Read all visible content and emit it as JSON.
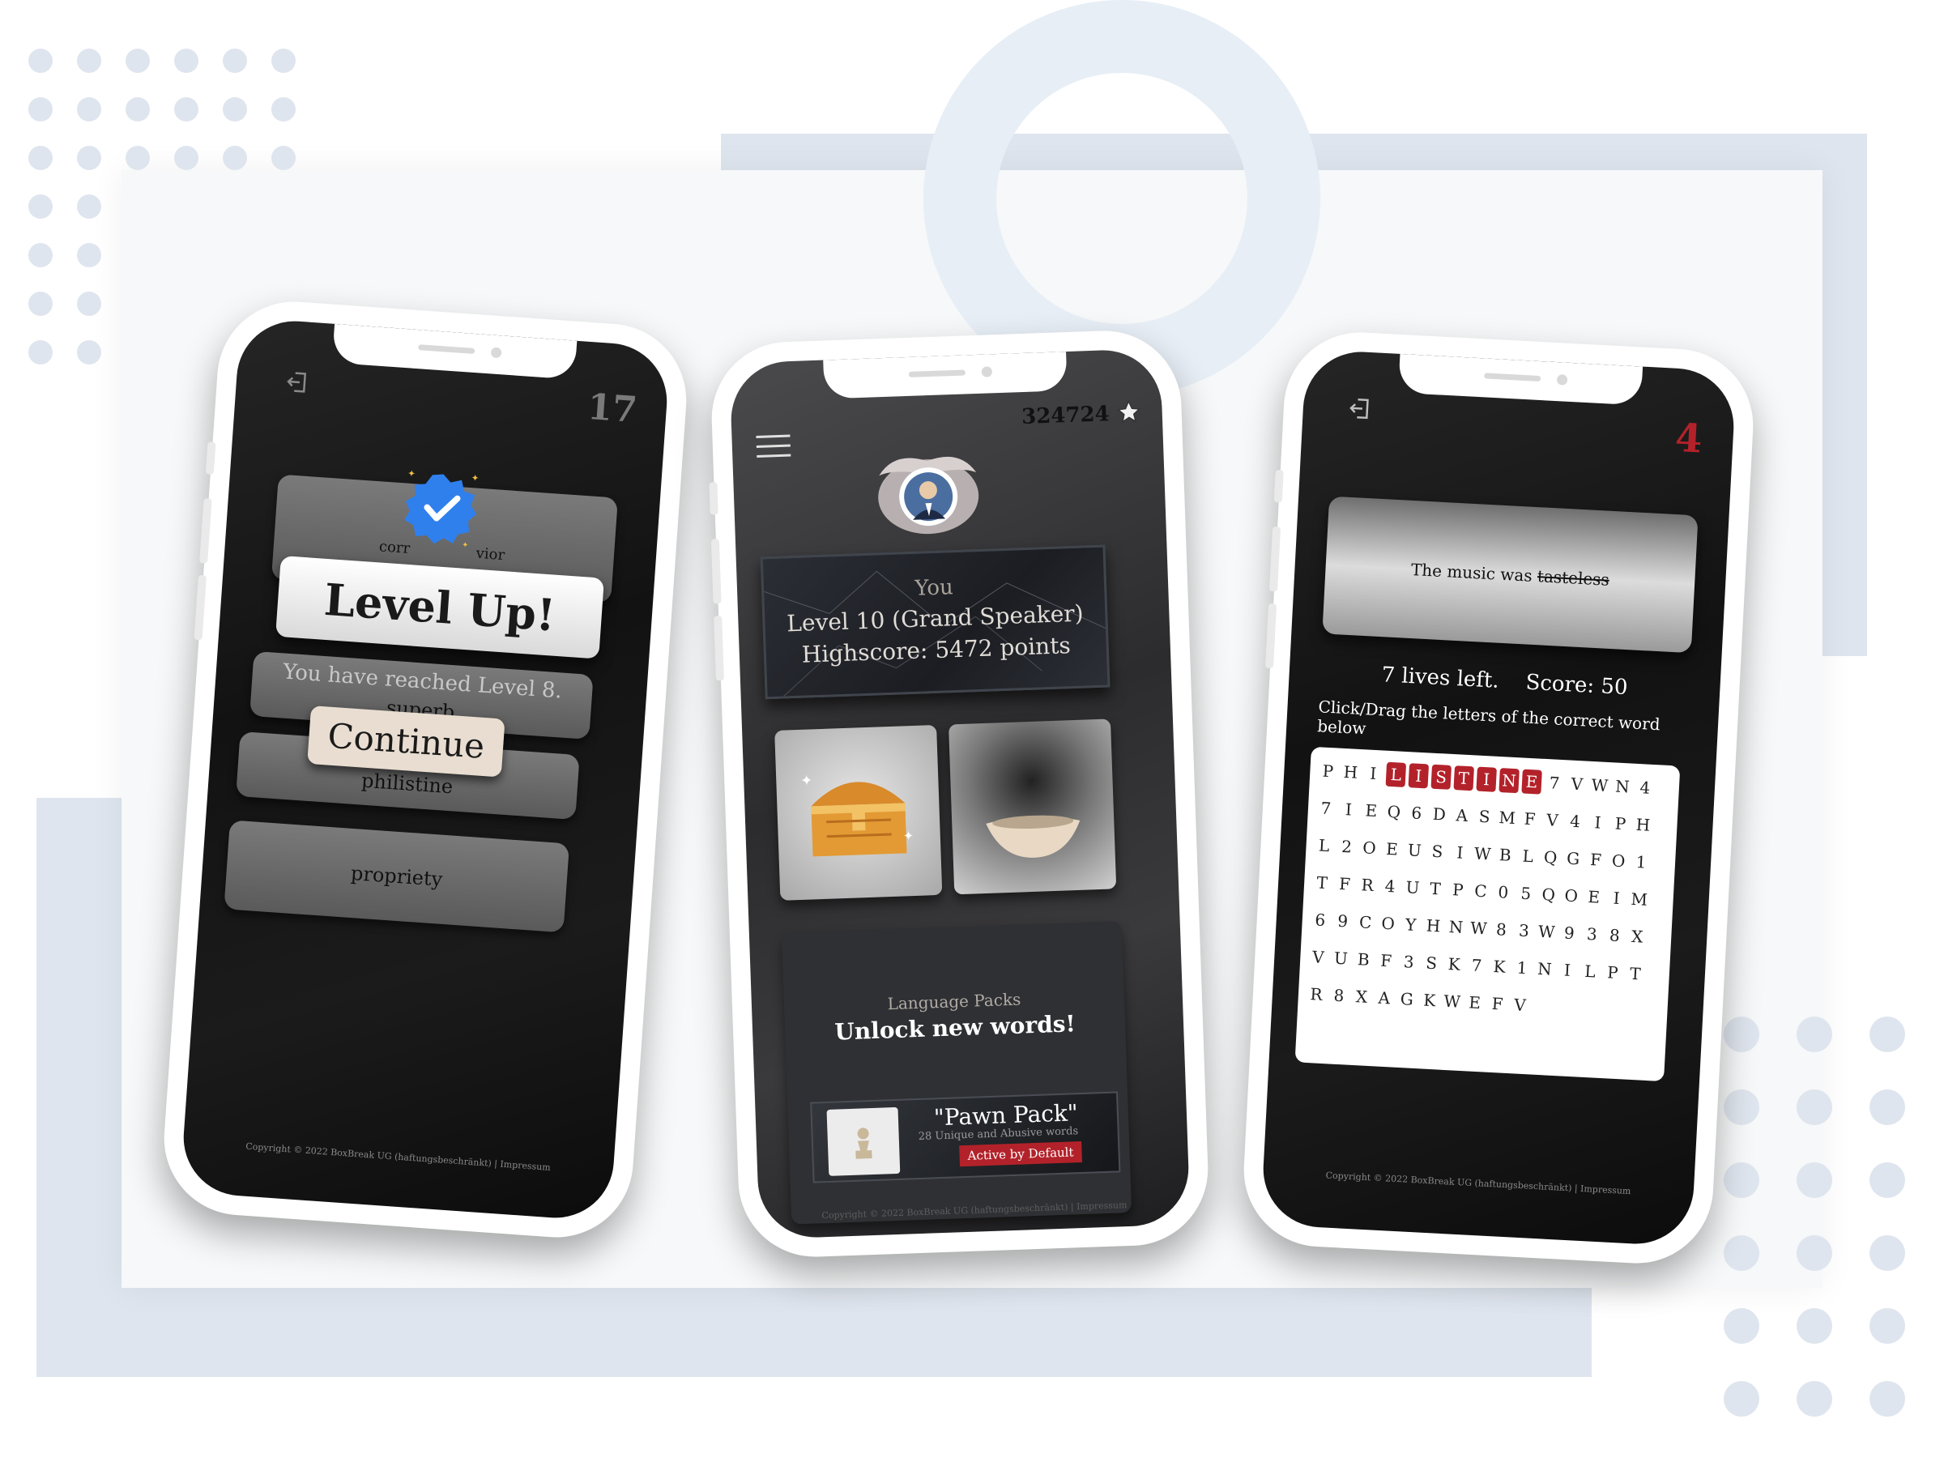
{
  "phone_left": {
    "level_counter": "17",
    "option_1_partial_left": "corr",
    "option_1_partial_right": "vior",
    "popup_title": "Level Up!",
    "popup_message": "You have reached Level 8.",
    "continue_label": "Continue",
    "option_2": "superb",
    "option_3": "philistine",
    "option_4": "propriety",
    "copyright": "Copyright © 2022 BoxBreak UG (haftungsbeschränkt) | Impressum"
  },
  "phone_middle": {
    "points": "324724",
    "profile_name": "You",
    "profile_level": "Level 10 (Grand Speaker)",
    "profile_highscore": "Highscore: 5472 points",
    "packs_subtitle": "Language Packs",
    "packs_title": "Unlock new words!",
    "pack_name": "\"Pawn Pack\"",
    "pack_desc": "28 Unique and Abusive words",
    "pack_badge": "Active by Default",
    "copyright": "Copyright © 2022 BoxBreak UG (haftungsbeschränkt) | Impressum"
  },
  "phone_right": {
    "timer": "4",
    "sentence_prefix": "The music was",
    "sentence_word": "tasteless",
    "lives": "7 lives left.",
    "score": "Score: 50",
    "instruction": "Click/Drag the letters of the correct word below",
    "grid_rows": [
      [
        "P",
        "H",
        "I",
        "L",
        "I",
        "S",
        "T",
        "I",
        "N",
        "E",
        "7",
        "V",
        "W",
        "N",
        "4"
      ],
      [
        "7",
        "I",
        "E",
        "Q",
        "6",
        "D",
        "A",
        "S",
        "M",
        "F",
        "V",
        "4",
        "I",
        "P",
        "H"
      ],
      [
        "L",
        "2",
        "O",
        "E",
        "U",
        "S",
        "I",
        "W",
        "B",
        "L",
        "Q",
        "G",
        "F",
        "O",
        "1"
      ],
      [
        "T",
        "F",
        "R",
        "4",
        "U",
        "T",
        "P",
        "C",
        "0",
        "5",
        "Q",
        "O",
        "E",
        "I",
        "M"
      ],
      [
        "6",
        "9",
        "C",
        "O",
        "Y",
        "H",
        "N",
        "W",
        "8",
        "3",
        "W",
        "9",
        "3",
        "8",
        "X"
      ],
      [
        "V",
        "U",
        "B",
        "F",
        "3",
        "S",
        "K",
        "7",
        "K",
        "1",
        "N",
        "I",
        "L",
        "P",
        "T"
      ],
      [
        "R",
        "8",
        "X",
        "A",
        "G",
        "K",
        "W",
        "E",
        "F",
        "V"
      ]
    ],
    "selected_letters": "LISTINE",
    "copyright": "Copyright © 2022 BoxBreak UG (haftungsbeschränkt) | Impressum"
  },
  "colors": {
    "accent_red": "#b3222a",
    "verified_blue": "#2f80ed",
    "decor_blue_grey": "#dfe5ee"
  },
  "icons": [
    "exit-icon",
    "verified-badge-icon",
    "hamburger-menu-icon",
    "star-icon",
    "treasure-chest-icon",
    "bowl-icon",
    "pawn-icon"
  ]
}
